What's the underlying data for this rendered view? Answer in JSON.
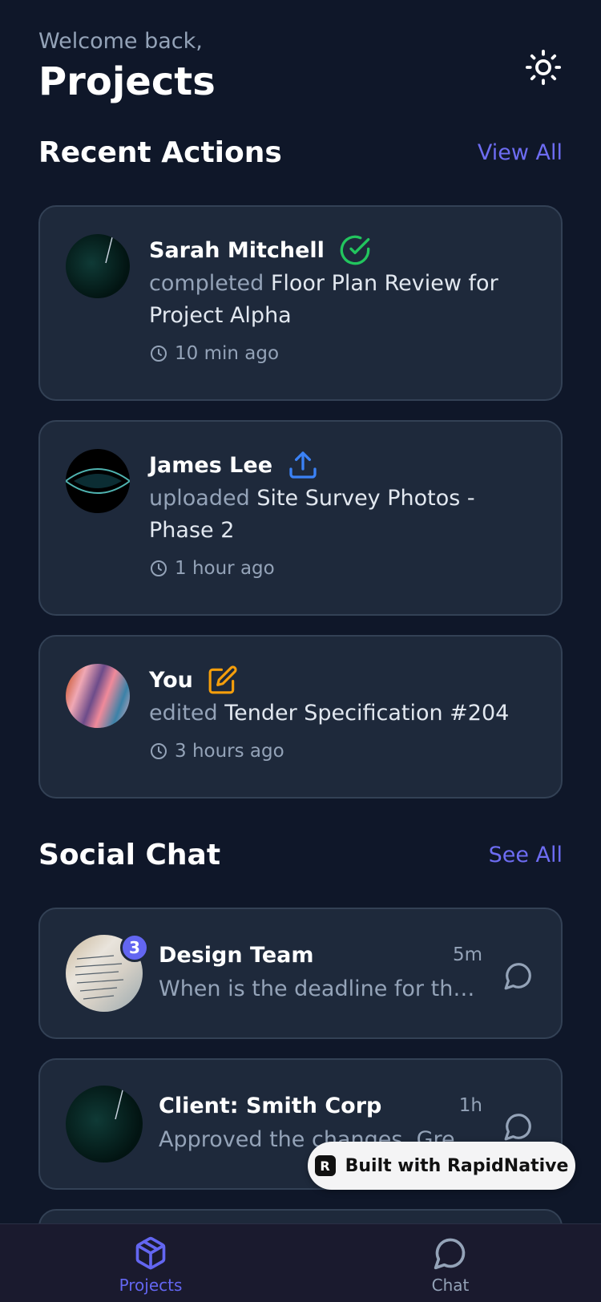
{
  "header": {
    "welcome": "Welcome back,",
    "title": "Projects",
    "theme_icon": "sun-icon"
  },
  "recent": {
    "title": "Recent Actions",
    "link": "View All",
    "items": [
      {
        "name": "Sarah Mitchell",
        "verb": "completed",
        "subject": "Floor Plan Review for Project Alpha",
        "time": "10 min ago",
        "icon": "check-circle-icon",
        "icon_color": "#22c55e"
      },
      {
        "name": "James Lee",
        "verb": "uploaded",
        "subject": "Site Survey Photos - Phase 2",
        "time": "1 hour ago",
        "icon": "upload-icon",
        "icon_color": "#3b82f6"
      },
      {
        "name": "You",
        "verb": "edited",
        "subject": "Tender Specification #204",
        "time": "3 hours ago",
        "icon": "edit-icon",
        "icon_color": "#f59e0b"
      }
    ]
  },
  "social": {
    "title": "Social Chat",
    "link": "See All",
    "items": [
      {
        "name": "Design Team",
        "time": "5m",
        "message": "When is the deadline for the revised drawings?",
        "badge": "3"
      },
      {
        "name": "Client: Smith Corp",
        "time": "1h",
        "message": "Approved the changes. Great work!"
      }
    ]
  },
  "watermark": {
    "text": "Built with RapidNative"
  },
  "tabs": [
    {
      "label": "Projects",
      "icon": "cube-icon",
      "active": true
    },
    {
      "label": "Chat",
      "icon": "chat-bubble-icon",
      "active": false
    }
  ],
  "colors": {
    "accent": "#6366f1",
    "background": "#0f1729",
    "card": "#1e293b"
  }
}
